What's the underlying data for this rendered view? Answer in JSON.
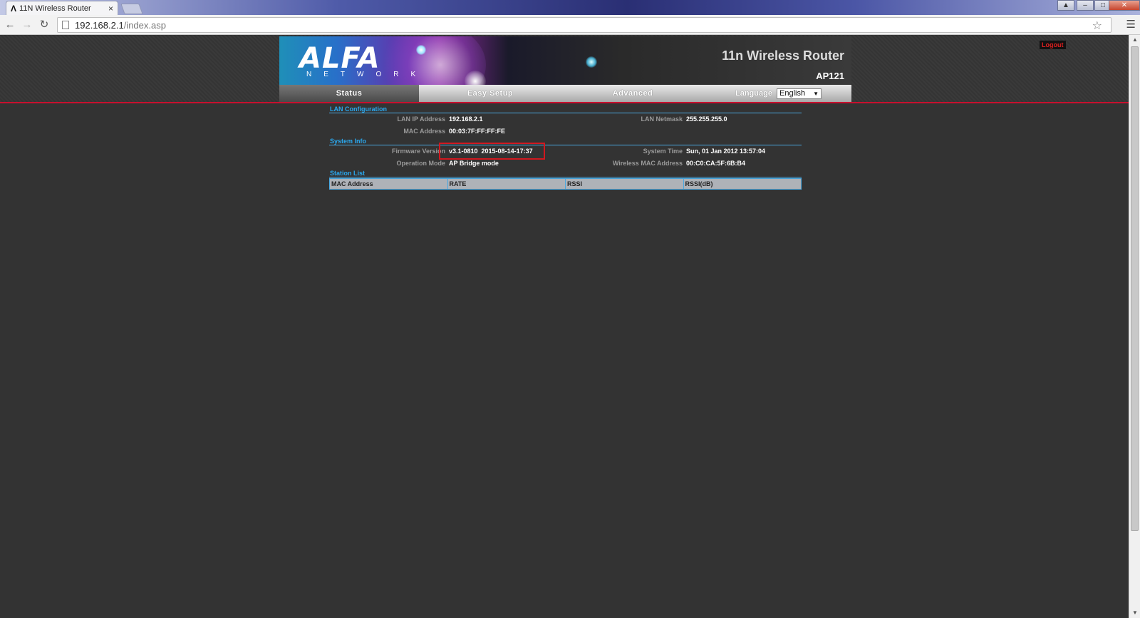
{
  "browser": {
    "tab_title": "11N Wireless Router",
    "tab_icon": "alfa-logo-icon",
    "tab_close": "×",
    "url_host": "192.168.2.1",
    "url_path": "/index.asp"
  },
  "header": {
    "logout": "Logout",
    "brand": "ALFA",
    "brand_sub": "NETWORK",
    "product_title": "11n Wireless Router",
    "model": "AP121"
  },
  "menu": {
    "status": "Status",
    "easy_setup": "Easy Setup",
    "advanced": "Advanced",
    "language_label": "Language",
    "language_value": "English"
  },
  "lan": {
    "title": "LAN Configuration",
    "ip_label": "LAN IP Address",
    "ip_value": "192.168.2.1",
    "netmask_label": "LAN Netmask",
    "netmask_value": "255.255.255.0",
    "mac_label": "MAC Address",
    "mac_value": "00:03:7F:FF:FF:FE"
  },
  "system": {
    "title": "System Info",
    "firmware_label": "Firmware Version",
    "firmware_value": "v3.1-0810  2015-08-14-17:37",
    "time_label": "System Time",
    "time_value": "Sun, 01 Jan 2012 13:57:04",
    "mode_label": "Operation Mode",
    "mode_value": "AP Bridge mode",
    "wmac_label": "Wireless MAC Address",
    "wmac_value": "00:C0:CA:5F:6B:B4"
  },
  "station": {
    "title": "Station List",
    "columns": [
      "MAC Address",
      "RATE",
      "RSSI",
      "RSSI(dB)"
    ]
  },
  "colors": {
    "accent_blue": "#2aa9f0",
    "header_red": "#c8102e",
    "highlight_red": "#d1181f"
  }
}
